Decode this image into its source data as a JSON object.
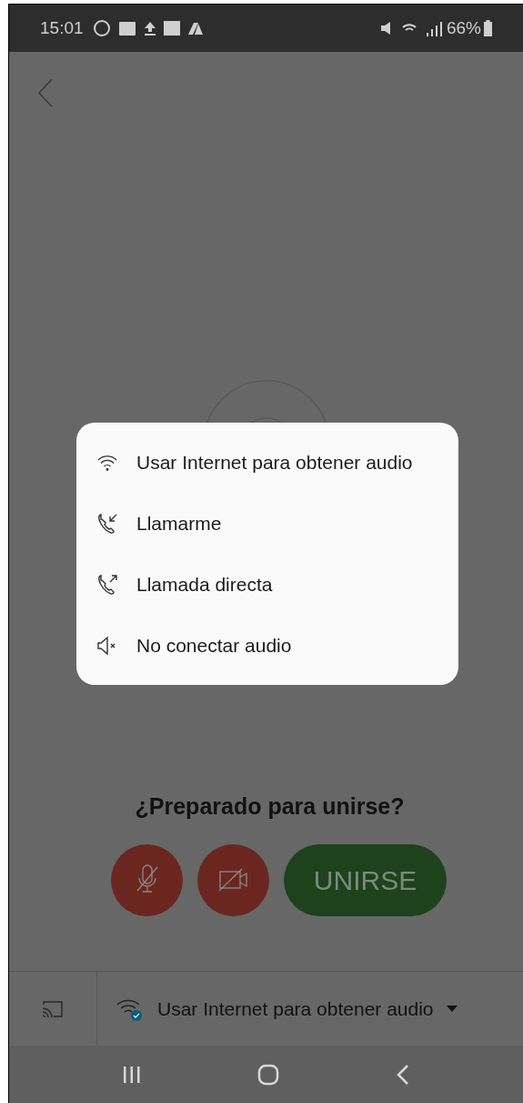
{
  "status_bar": {
    "time": "15:01",
    "battery": "66%"
  },
  "audio_menu": {
    "items": [
      {
        "kind": "internet",
        "label": "Usar Internet para obtener audio"
      },
      {
        "kind": "call_me",
        "label": "Llamarme"
      },
      {
        "kind": "call_in",
        "label": "Llamada directa"
      },
      {
        "kind": "no_audio",
        "label": "No conectar audio"
      }
    ]
  },
  "prompt": "¿Preparado para unirse?",
  "controls": {
    "microphone": {
      "on": false
    },
    "camera": {
      "on": false
    },
    "join_button": "UNIRSE"
  },
  "audio_selector": {
    "label": "Usar Internet para obtener audio"
  }
}
